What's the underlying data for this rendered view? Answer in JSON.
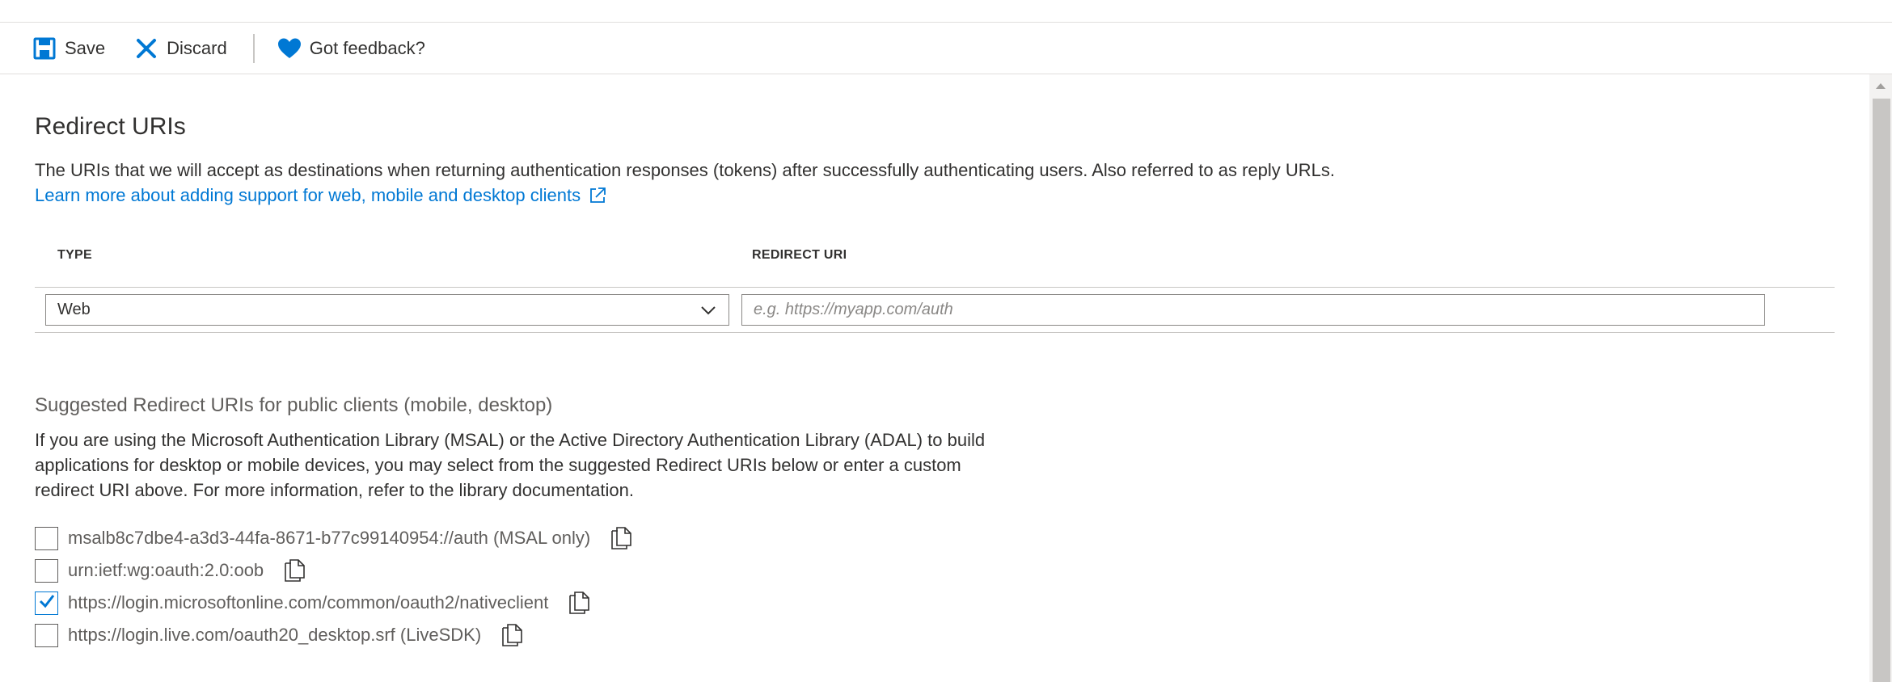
{
  "toolbar": {
    "save_label": "Save",
    "discard_label": "Discard",
    "feedback_label": "Got feedback?"
  },
  "redirect": {
    "title": "Redirect URIs",
    "description": "The URIs that we will accept as destinations when returning authentication responses (tokens) after successfully authenticating users. Also referred to as reply URLs.",
    "learn_more": "Learn more about adding support for web, mobile and desktop clients",
    "col_type": "TYPE",
    "col_uri": "REDIRECT URI",
    "type_value": "Web",
    "uri_placeholder": "e.g. https://myapp.com/auth",
    "uri_value": ""
  },
  "suggested": {
    "title": "Suggested Redirect URIs for public clients (mobile, desktop)",
    "paragraph": "If you are using the Microsoft Authentication Library (MSAL) or the Active Directory Authentication Library (ADAL) to build applications for desktop or mobile devices, you may select from the suggested Redirect URIs below or enter a custom redirect URI above. For more information, refer to the library documentation.",
    "items": [
      {
        "label": "msalb8c7dbe4-a3d3-44fa-8671-b77c99140954://auth (MSAL only)",
        "checked": false
      },
      {
        "label": "urn:ietf:wg:oauth:2.0:oob",
        "checked": false
      },
      {
        "label": "https://login.microsoftonline.com/common/oauth2/nativeclient",
        "checked": true
      },
      {
        "label": "https://login.live.com/oauth20_desktop.srf (LiveSDK)",
        "checked": false
      }
    ]
  },
  "colors": {
    "accent": "#0078d4",
    "text": "#323130",
    "muted": "#605e5c",
    "border": "#8a8886"
  }
}
